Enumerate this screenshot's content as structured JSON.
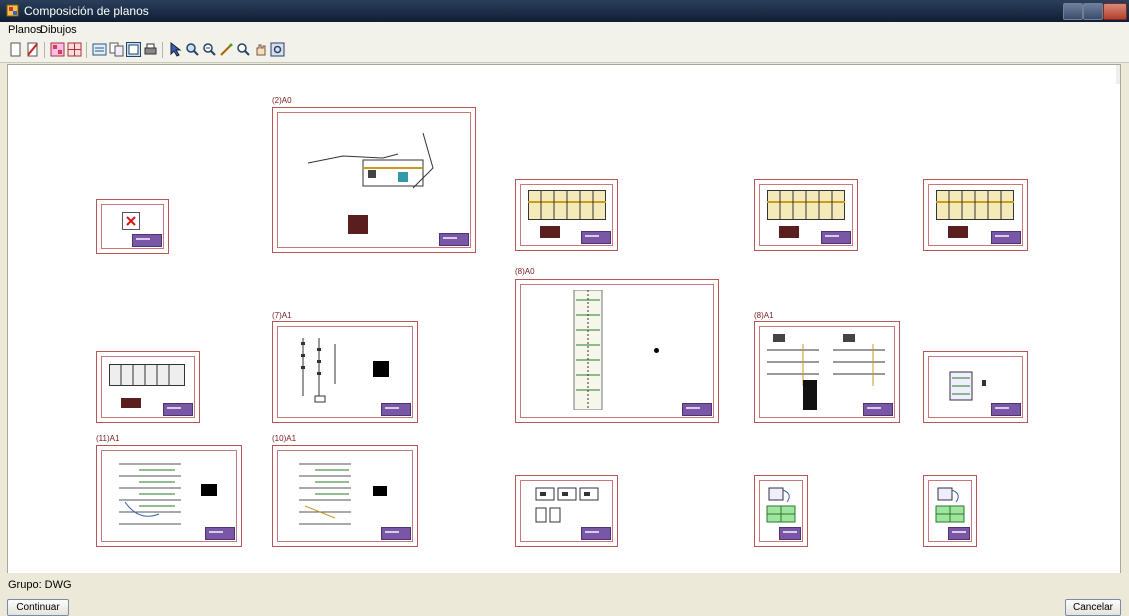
{
  "window": {
    "title": "Composición de planos"
  },
  "menu": {
    "items": [
      "Planos",
      "Dibujos"
    ]
  },
  "toolbar": {
    "icons": [
      "new-plan-icon",
      "delete-plan-icon",
      "plan-list-icon",
      "plan-grid-icon",
      "plan-properties-icon",
      "copy-icon",
      "select-drawing-icon",
      "print-icon",
      "select-arrow-icon",
      "zoom-window-icon",
      "zoom-icon",
      "rename-icon",
      "magnifier-icon",
      "pan-icon",
      "refresh-view-icon"
    ]
  },
  "sheets": {
    "s2": {
      "label": "(2)A0"
    },
    "s8": {
      "label": "(8)A0"
    },
    "s7": {
      "label": "(7)A1"
    },
    "s9": {
      "label": "(8)A1"
    },
    "s11": {
      "label": "(11)A1"
    },
    "s10": {
      "label": "(10)A1"
    }
  },
  "status": {
    "grupo": "Grupo: DWG"
  },
  "buttons": {
    "continue": "Continuar",
    "cancel": "Cancelar"
  },
  "colors": {
    "sheet_border": "#b95555",
    "title_block": "#7a57a6",
    "titlebar": "#1a2b45"
  }
}
